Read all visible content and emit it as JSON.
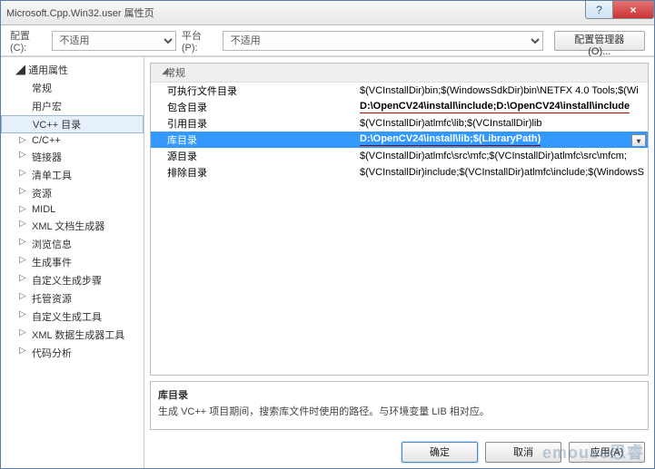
{
  "window": {
    "title": "Microsoft.Cpp.Win32.user 属性页"
  },
  "toolbar": {
    "config_label": "配置(C):",
    "config_value": "不适用",
    "platform_label": "平台(P):",
    "platform_value": "不适用",
    "cfgmgr": "配置管理器(O)..."
  },
  "tree": {
    "root": "通用属性",
    "items": [
      {
        "label": "常规"
      },
      {
        "label": "用户宏"
      },
      {
        "label": "VC++ 目录",
        "selected": true
      },
      {
        "label": "C/C++",
        "expandable": true
      },
      {
        "label": "链接器",
        "expandable": true
      },
      {
        "label": "清单工具",
        "expandable": true
      },
      {
        "label": "资源",
        "expandable": true
      },
      {
        "label": "MIDL",
        "expandable": true
      },
      {
        "label": "XML 文档生成器",
        "expandable": true
      },
      {
        "label": "浏览信息",
        "expandable": true
      },
      {
        "label": "生成事件",
        "expandable": true
      },
      {
        "label": "自定义生成步骤",
        "expandable": true
      },
      {
        "label": "托管资源",
        "expandable": true
      },
      {
        "label": "自定义生成工具",
        "expandable": true
      },
      {
        "label": "XML 数据生成器工具",
        "expandable": true
      },
      {
        "label": "代码分析",
        "expandable": true
      }
    ]
  },
  "grid": {
    "group": "常规",
    "rows": [
      {
        "name": "可执行文件目录",
        "value": "$(VCInstallDir)bin;$(WindowsSdkDir)bin\\NETFX 4.0 Tools;$(Wi",
        "bold": false
      },
      {
        "name": "包含目录",
        "value": "D:\\OpenCV24\\install\\include;D:\\OpenCV24\\install\\include",
        "bold": true,
        "redline": true
      },
      {
        "name": "引用目录",
        "value": "$(VCInstallDir)atlmfc\\lib;$(VCInstallDir)lib",
        "bold": false
      },
      {
        "name": "库目录",
        "value": "D:\\OpenCV24\\install\\lib;$(LibraryPath)",
        "bold": true,
        "redline": true,
        "selected": true,
        "dropdown": true
      },
      {
        "name": "源目录",
        "value": "$(VCInstallDir)atlmfc\\src\\mfc;$(VCInstallDir)atlmfc\\src\\mfcm;",
        "bold": false
      },
      {
        "name": "排除目录",
        "value": "$(VCInstallDir)include;$(VCInstallDir)atlmfc\\include;$(WindowsS",
        "bold": false
      }
    ]
  },
  "desc": {
    "title": "库目录",
    "text": "生成 VC++ 项目期间，搜索库文件时使用的路径。与环境变量 LIB 相对应。"
  },
  "footer": {
    "ok": "确定",
    "cancel": "取消",
    "apply": "应用(A)"
  },
  "watermark": "emouse思睿"
}
